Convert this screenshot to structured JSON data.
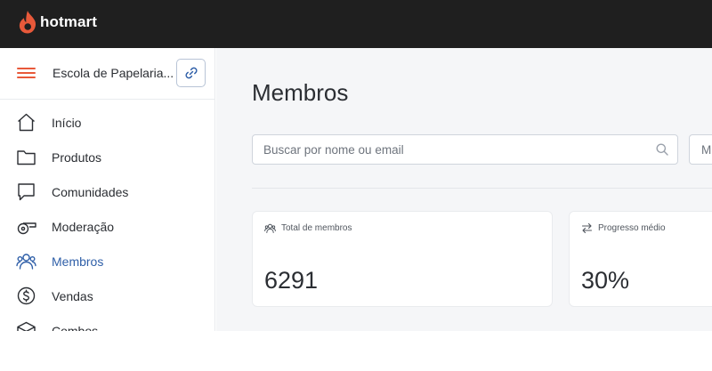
{
  "app": {
    "brand": "hotmart",
    "brand_color": "#e8593a"
  },
  "sidebar": {
    "school_name": "Escola de Papelaria...",
    "items": [
      {
        "label": "Início",
        "icon": "home-icon"
      },
      {
        "label": "Produtos",
        "icon": "folder-icon"
      },
      {
        "label": "Comunidades",
        "icon": "chat-bubble-icon"
      },
      {
        "label": "Moderação",
        "icon": "whistle-icon"
      },
      {
        "label": "Membros",
        "icon": "users-icon",
        "active": true
      },
      {
        "label": "Vendas",
        "icon": "dollar-circle-icon"
      },
      {
        "label": "Combos",
        "icon": "box-icon"
      }
    ],
    "active_color": "#2f5fa8"
  },
  "main": {
    "title": "Membros",
    "search": {
      "placeholder": "Buscar por nome ou email",
      "value": ""
    },
    "filter_label": "M",
    "cards": [
      {
        "label": "Total de membros",
        "value": "6291",
        "icon": "users-icon"
      },
      {
        "label": "Progresso médio",
        "value": "30%",
        "icon": "progress-arrows-icon"
      }
    ]
  }
}
